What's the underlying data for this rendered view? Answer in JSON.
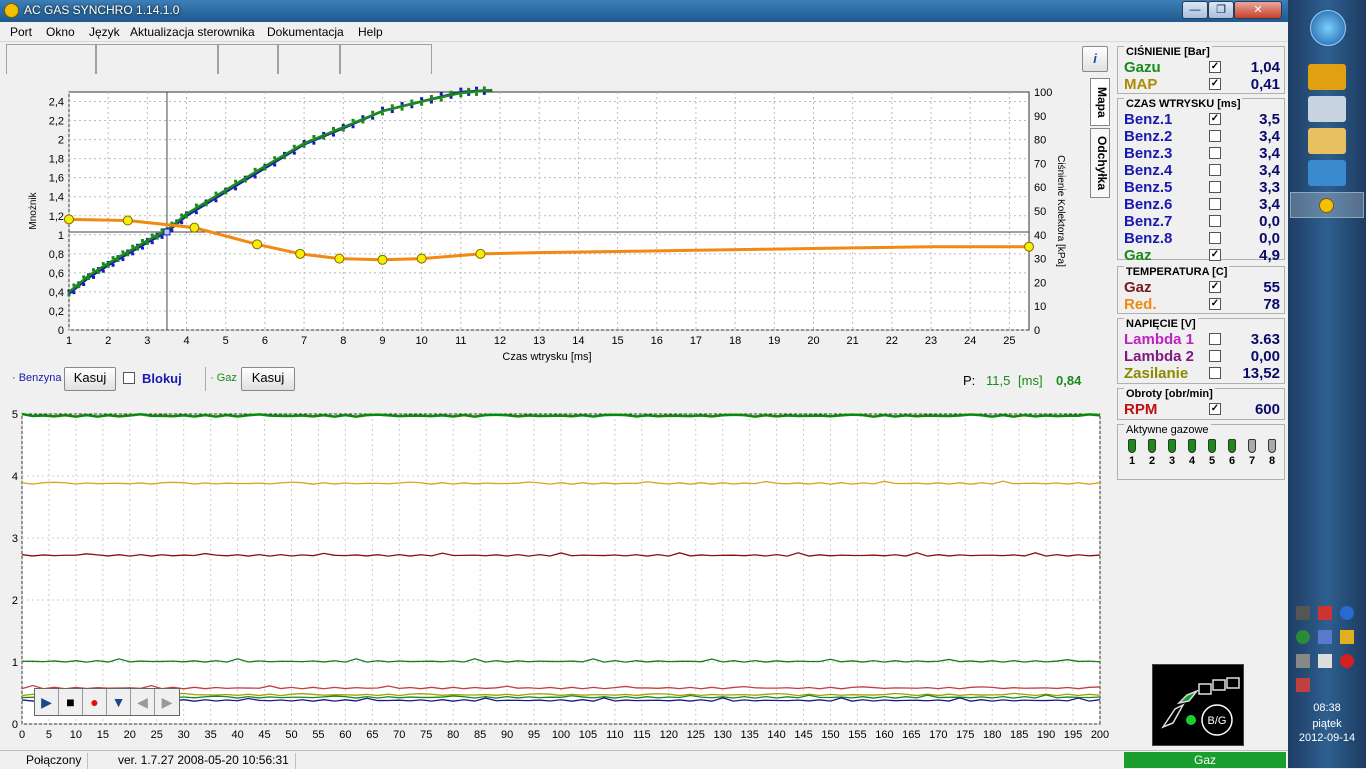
{
  "window": {
    "title": "AC GAS SYNCHRO   1.14.1.0",
    "min": "—",
    "max": "❐",
    "close": "✕"
  },
  "menu": [
    "Port",
    "Okno",
    "Język",
    "Aktualizacja sterownika",
    "Dokumentacja",
    "Help"
  ],
  "side_tabs": {
    "mapa": "Mapa",
    "odchylka": "Odchyłka",
    "info_icon": "i"
  },
  "top_chart": {
    "ylabel_left": "Mnożnik",
    "ylabel_right": "Ciśnienie Kolektora [kPa]",
    "xlabel": "Czas wtrysku [ms]",
    "y_ticks_left": [
      "0",
      "0,2",
      "0,4",
      "0,6",
      "0,8",
      "1",
      "1,2",
      "1,4",
      "1,6",
      "1,8",
      "2",
      "2,2",
      "2,4"
    ],
    "y_ticks_right": [
      "0",
      "10",
      "20",
      "30",
      "40",
      "50",
      "60",
      "70",
      "80",
      "90",
      "100"
    ],
    "x_ticks": [
      "1",
      "2",
      "3",
      "4",
      "5",
      "6",
      "7",
      "8",
      "9",
      "10",
      "11",
      "12",
      "13",
      "14",
      "15",
      "16",
      "17",
      "18",
      "19",
      "20",
      "21",
      "22",
      "23",
      "24",
      "25"
    ],
    "colors": {
      "benz": "#1a1ab0",
      "gaz": "#1a8a1a",
      "map": "#f08a10",
      "node": "#f5f000"
    }
  },
  "chart_data": [
    {
      "type": "line",
      "title": "",
      "xlabel": "Czas wtrysku [ms]",
      "ylabel": "Mnożnik",
      "xlim": [
        1,
        25.5
      ],
      "ylim": [
        0,
        2.5
      ],
      "y2label": "Ciśnienie Kolektora [kPa]",
      "y2lim": [
        0,
        100
      ],
      "series": [
        {
          "name": "Benzyna",
          "x": [
            1,
            1.5,
            2,
            2.5,
            3,
            3.5,
            4,
            5,
            6,
            7,
            8,
            9,
            10,
            11,
            11.8
          ],
          "values": [
            0.38,
            0.55,
            0.68,
            0.8,
            0.92,
            1.03,
            1.2,
            1.45,
            1.7,
            1.95,
            2.12,
            2.3,
            2.4,
            2.5,
            2.52
          ]
        },
        {
          "name": "Gaz",
          "x": [
            1,
            1.5,
            2,
            2.5,
            3,
            3.5,
            4,
            5,
            6,
            7,
            8,
            9,
            10,
            11,
            11.8
          ],
          "values": [
            0.4,
            0.57,
            0.7,
            0.82,
            0.94,
            1.05,
            1.22,
            1.47,
            1.72,
            1.96,
            2.13,
            2.3,
            2.4,
            2.49,
            2.52
          ]
        },
        {
          "x": [
            1,
            2.5,
            4.2,
            5.8,
            6.9,
            7.9,
            9,
            10,
            11.5,
            13,
            15,
            17,
            19,
            21,
            23,
            25.5
          ],
          "values": [
            46.5,
            46,
            43,
            36,
            32,
            30,
            29.5,
            30,
            32,
            32.5,
            33,
            33.5,
            34,
            34.5,
            35,
            35
          ]
        }
      ],
      "map_nodes_x": [
        1,
        2.5,
        4.2,
        5.8,
        6.9,
        7.9,
        9,
        10,
        11.5,
        25.5
      ],
      "cursor_x": 3.5,
      "cursor_y": 1.03
    },
    {
      "type": "line",
      "title": "",
      "xlim": [
        0,
        200
      ],
      "ylim": [
        0,
        5
      ],
      "x_ticks": [
        "0",
        "5",
        "10",
        "15",
        "20",
        "25",
        "30",
        "35",
        "40",
        "45",
        "50",
        "55",
        "60",
        "65",
        "70",
        "75",
        "80",
        "85",
        "90",
        "95",
        "100",
        "105",
        "110",
        "115",
        "120",
        "125",
        "130",
        "135",
        "140",
        "145",
        "150",
        "155",
        "160",
        "165",
        "170",
        "175",
        "180",
        "185",
        "190",
        "195",
        "200"
      ],
      "y_ticks": [
        "0",
        "1",
        "2",
        "3",
        "4",
        "5"
      ],
      "series": [
        {
          "color": "#0a8a0a",
          "level": 4.97
        },
        {
          "color": "#e0a020",
          "level": 3.88
        },
        {
          "color": "#8a1010",
          "level": 2.72
        },
        {
          "color": "#1a7a1a",
          "level": 1.01
        },
        {
          "color": "#c04040",
          "level": 0.58
        },
        {
          "color": "#a0a000",
          "level": 0.47
        },
        {
          "color": "#1a8a1a",
          "level": 0.43
        },
        {
          "color": "#1a1a8a",
          "level": 0.38
        }
      ]
    }
  ],
  "controls": {
    "benzyna_label": "· Benzyna",
    "kasuj1": "Kasuj",
    "blokuj": "Blokuj",
    "gaz_label": "· Gaz",
    "kasuj2": "Kasuj",
    "p_label": "P:",
    "p_value": "11,5",
    "p_unit": "[ms]",
    "p_value2": "0,84"
  },
  "panel": {
    "cisnienie": {
      "title": "CIŚNIENIE [Bar]",
      "rows": [
        {
          "label": "Gazu",
          "color": "#1a8a1a",
          "checked": true,
          "value": "1,04"
        },
        {
          "label": "MAP",
          "color": "#b08a00",
          "checked": true,
          "value": "0,41"
        }
      ]
    },
    "czas": {
      "title": "CZAS WTRYSKU  [ms]",
      "rows": [
        {
          "label": "Benz.1",
          "color": "#1a1ab0",
          "checked": true,
          "value": "3,5"
        },
        {
          "label": "Benz.2",
          "color": "#1a1ab0",
          "checked": false,
          "value": "3,4"
        },
        {
          "label": "Benz.3",
          "color": "#1a1ab0",
          "checked": false,
          "value": "3,4"
        },
        {
          "label": "Benz.4",
          "color": "#1a1ab0",
          "checked": false,
          "value": "3,4"
        },
        {
          "label": "Benz.5",
          "color": "#1a1ab0",
          "checked": false,
          "value": "3,3"
        },
        {
          "label": "Benz.6",
          "color": "#1a1ab0",
          "checked": false,
          "value": "3,4"
        },
        {
          "label": "Benz.7",
          "color": "#1a1ab0",
          "checked": false,
          "value": "0,0"
        },
        {
          "label": "Benz.8",
          "color": "#1a1ab0",
          "checked": false,
          "value": "0,0"
        },
        {
          "label": "Gaz",
          "color": "#1a8a1a",
          "checked": true,
          "value": "4,9"
        }
      ]
    },
    "temperatura": {
      "title": "TEMPERATURA  [C]",
      "rows": [
        {
          "label": "Gaz",
          "color": "#7a1a1a",
          "checked": true,
          "value": "55"
        },
        {
          "label": "Red.",
          "color": "#f08a10",
          "checked": true,
          "value": "78"
        }
      ]
    },
    "napiecie": {
      "title": "NAPIĘCIE [V]",
      "rows": [
        {
          "label": "Lambda 1",
          "color": "#c020c0",
          "checked": false,
          "value": "3.63"
        },
        {
          "label": "Lambda 2",
          "color": "#801a80",
          "checked": false,
          "value": "0,00"
        },
        {
          "label": "Zasilanie",
          "color": "#8a8a00",
          "checked": false,
          "value": "13,52"
        }
      ]
    },
    "obroty": {
      "title": "Obroty [obr/min]",
      "rows": [
        {
          "label": "RPM",
          "color": "#c01010",
          "checked": true,
          "value": "600"
        }
      ]
    },
    "aktywne": {
      "title": "Aktywne gazowe",
      "injectors": [
        "1",
        "2",
        "3",
        "4",
        "5",
        "6",
        "7",
        "8"
      ],
      "active": [
        true,
        true,
        true,
        true,
        true,
        true,
        false,
        false
      ]
    }
  },
  "bg_widget": {
    "label": "B/G"
  },
  "status": {
    "connection": "Połączony",
    "version": "ver. 1.7.27   2008-05-20  10:56:31",
    "mode": "Gaz"
  },
  "taskbar": {
    "time": "08:38",
    "day": "piątek",
    "date": "2012-09-14"
  }
}
